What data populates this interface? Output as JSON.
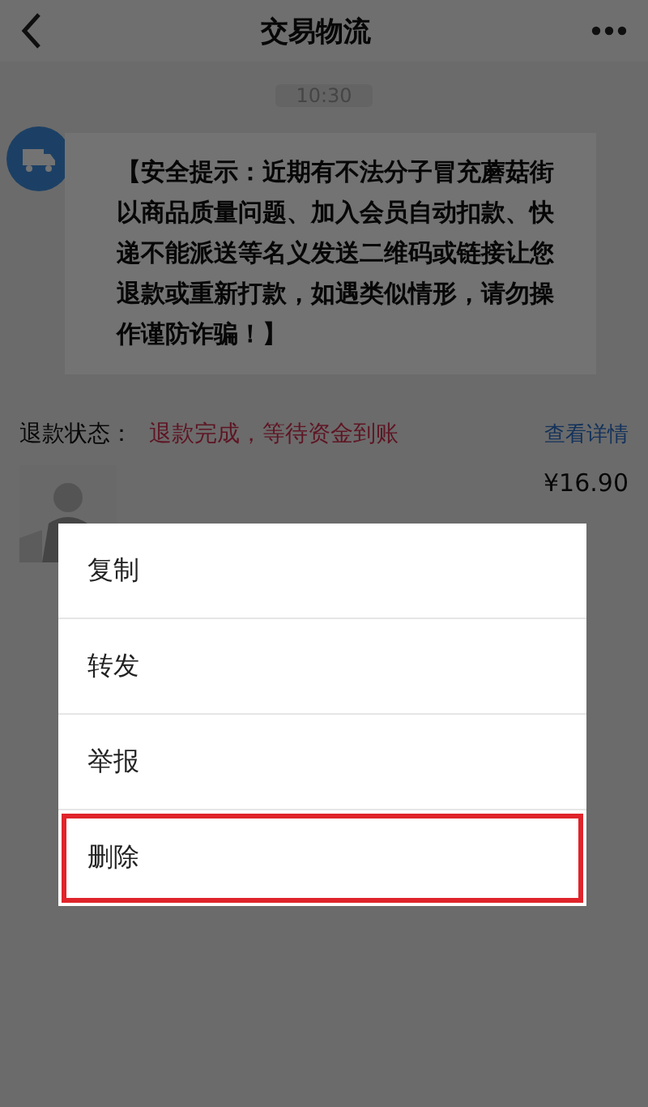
{
  "header": {
    "title": "交易物流"
  },
  "time": "10:30",
  "message": {
    "text": "【安全提示：近期有不法分子冒充蘑菇街以商品质量问题、加入会员自动扣款、快递不能派送等名义发送二维码或链接让您退款或重新打款，如遇类似情形，请勿操作谨防诈骗！】"
  },
  "refund": {
    "label": "退款状态：",
    "status": "退款完成，等待资金到账",
    "link": "查看详情"
  },
  "product": {
    "price": "¥16.90"
  },
  "menu": [
    {
      "label": "复制",
      "highlighted": false
    },
    {
      "label": "转发",
      "highlighted": false
    },
    {
      "label": "举报",
      "highlighted": false
    },
    {
      "label": "删除",
      "highlighted": true
    }
  ]
}
